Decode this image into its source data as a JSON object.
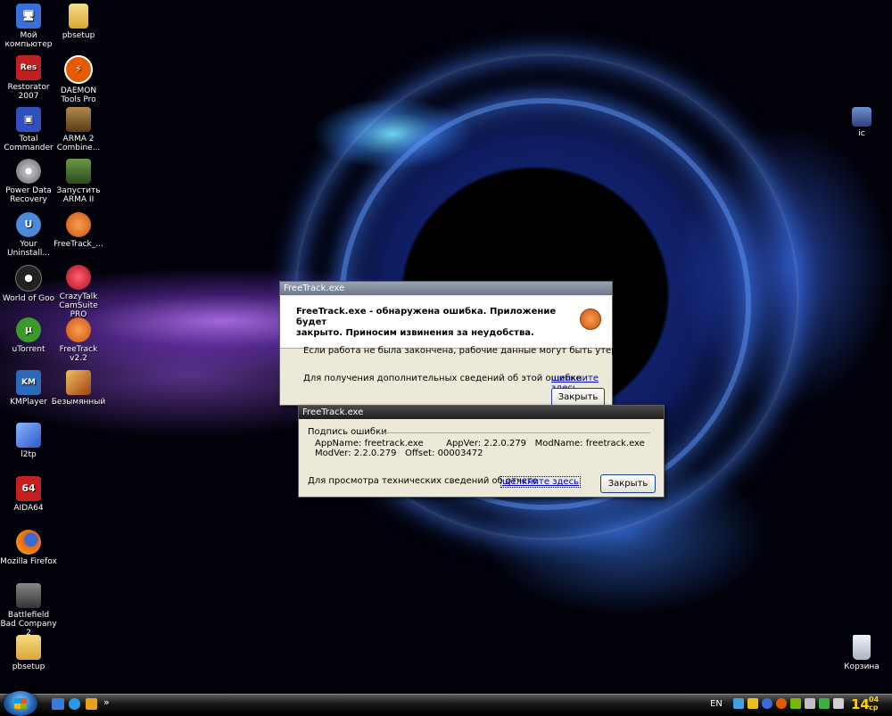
{
  "desktop_icons": [
    {
      "label": "Мой компьютер",
      "icon": "computer-icon",
      "color": "#3a6fd8"
    },
    {
      "label": "pbsetup",
      "icon": "folder-icon",
      "color": "#e8c45a"
    },
    {
      "label": "Restorator 2007",
      "icon": "restorator-icon",
      "color": "#c02020",
      "glyph": "Res"
    },
    {
      "label": "DAEMON Tools Pro",
      "icon": "daemon-tools-icon",
      "color": "#e65a00",
      "glyph": "⚡"
    },
    {
      "label": "Total Commander",
      "icon": "floppy-disk-icon",
      "color": "#3050c0",
      "glyph": "▣"
    },
    {
      "label": "ARMA 2 Combine...",
      "icon": "arma2-icon",
      "color": "#8a6a3a"
    },
    {
      "label": "Power Data Recovery",
      "icon": "disc-icon",
      "color": "#bbbbbb"
    },
    {
      "label": "Запустить ARMA II",
      "icon": "soldier-icon",
      "color": "#3d6a2e"
    },
    {
      "label": "Your Uninstall...",
      "icon": "uninstaller-icon",
      "color": "#4a8ad8",
      "glyph": "U"
    },
    {
      "label": "FreeTrack_...",
      "icon": "freetrack-icon",
      "color": "#e06020"
    },
    {
      "label": "World of Goo",
      "icon": "goo-ball-icon",
      "color": "#222222",
      "glyph": "●"
    },
    {
      "label": "CrazyTalk CamSuite PRO",
      "icon": "lips-icon",
      "color": "#d02030"
    },
    {
      "label": "uTorrent",
      "icon": "utorrent-icon",
      "color": "#3c9a2c",
      "glyph": "µ"
    },
    {
      "label": "FreeTrack v2.2",
      "icon": "freetrack-icon",
      "color": "#e06020"
    },
    {
      "label": "KMPlayer",
      "icon": "kmplayer-icon",
      "color": "#2a6ab8",
      "glyph": "KM"
    },
    {
      "label": "Безымянный",
      "icon": "image-file-icon",
      "color": "#c47a20"
    },
    {
      "label": "l2tp",
      "icon": "network-icon",
      "color": "#4a7ad8"
    },
    {
      "label": "AIDA64",
      "icon": "aida64-icon",
      "color": "#c42020",
      "glyph": "64"
    },
    {
      "label": "Mozilla Firefox",
      "icon": "firefox-icon",
      "color": "#e66a10"
    },
    {
      "label": "Battlefield Bad Company 2",
      "icon": "battlefield-icon",
      "color": "#555555"
    },
    {
      "label": "pbsetup",
      "icon": "zip-folder-icon",
      "color": "#e8c45a"
    },
    {
      "label": "ic",
      "icon": "shortcut-icon",
      "color": "#4060a0"
    },
    {
      "label": "Корзина",
      "icon": "recycle-bin-icon",
      "color": "#cfd8e0"
    }
  ],
  "dialog_main": {
    "title": "FreeTrack.exe",
    "heading": "FreeTrack.exe - обнаружена ошибка. Приложение будет закрыто. Приносим извинения за неудобства.",
    "heading_line1": "FreeTrack.exe - обнаружена ошибка. Приложение будет",
    "heading_line2": "закрыто. Приносим извинения за неудобства.",
    "warning": "Если работа не была закончена, рабочие данные могут быть утеряны.",
    "more_info_text": "Для получения дополнительных сведений об этой ошибке",
    "more_info_link": "щелкните здесь.",
    "close_label": "Закрыть"
  },
  "dialog_details": {
    "title": "FreeTrack.exe",
    "group_label": "Подпись ошибки",
    "signature_line1": "AppName: freetrack.exe        AppVer: 2.2.0.279   ModName: freetrack.exe",
    "signature_line2": "ModVer: 2.2.0.279   Offset: 00003472",
    "tech_text": "Для просмотра технических сведений об отчете",
    "tech_link": "щелкните здесь",
    "close_label": "Закрыть"
  },
  "taskbar": {
    "language": "EN",
    "time_hour": "14",
    "time_min": "04",
    "day": "ср",
    "quicklaunch": [
      "windows-explorer-icon",
      "internet-explorer-icon",
      "media-player-icon"
    ],
    "overflow": "»"
  },
  "colors": {
    "dialog_bg": "#ece9d8",
    "link": "#0000cc",
    "time": "#ffd200"
  }
}
